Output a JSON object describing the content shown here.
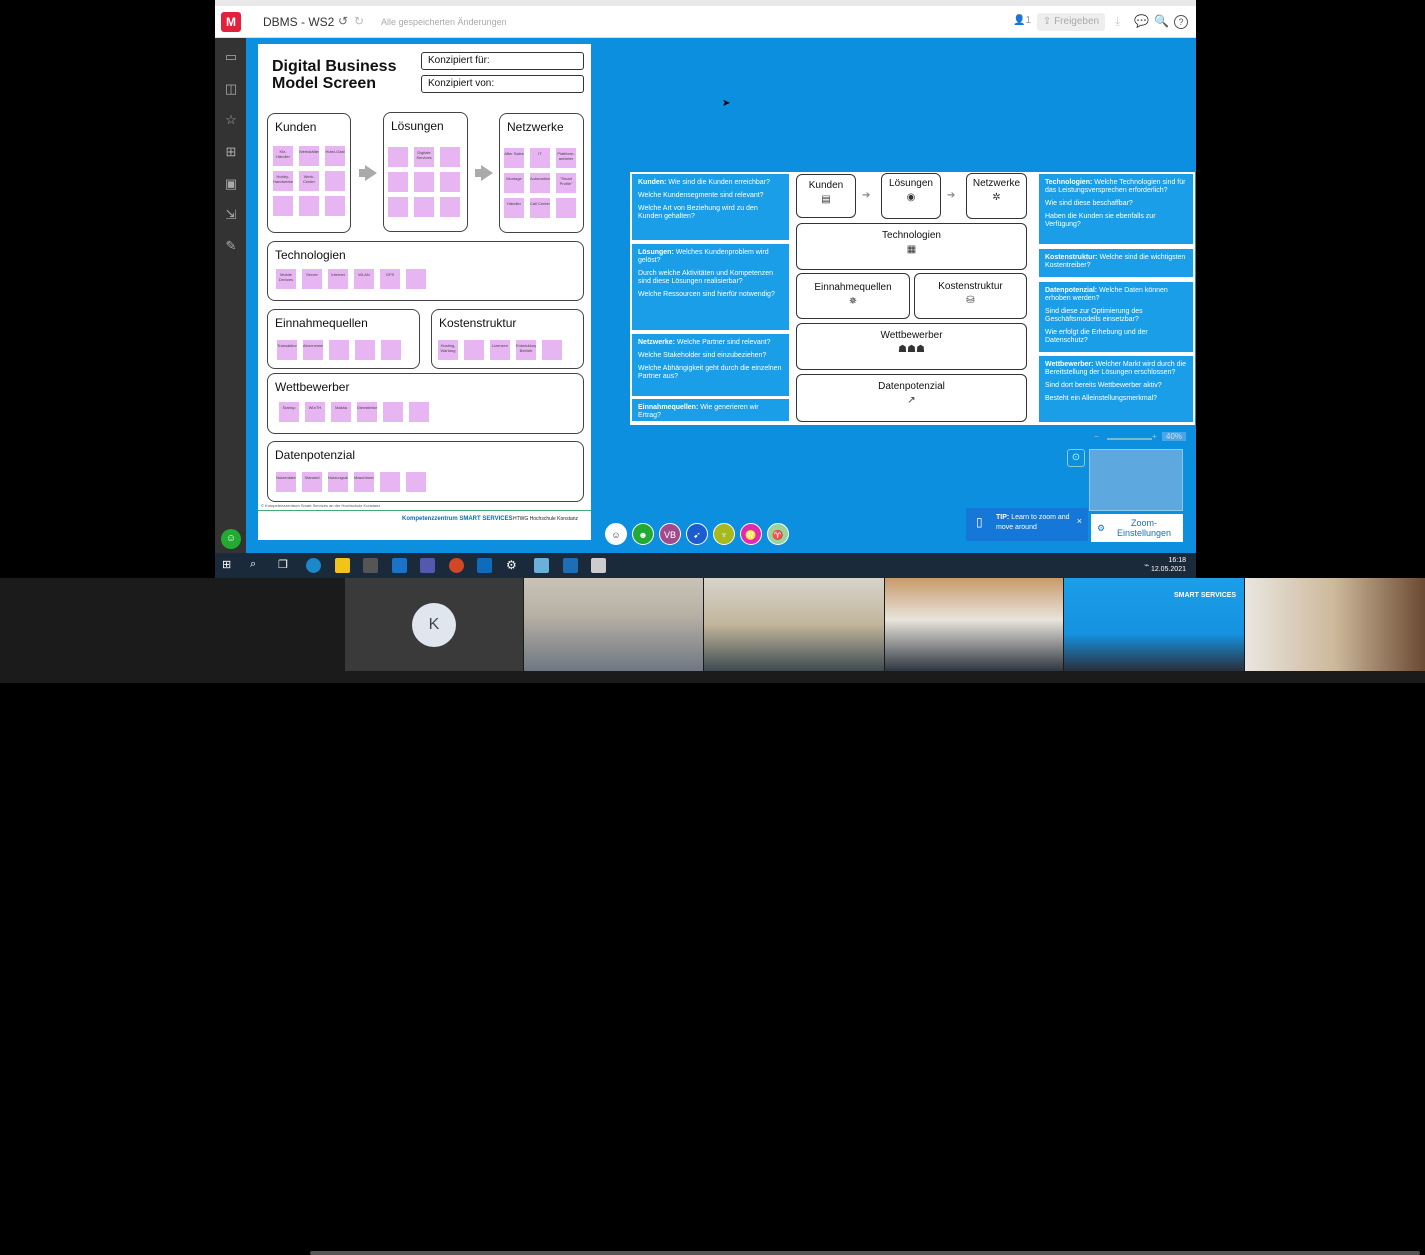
{
  "app": {
    "board_title": "DBMS - WS2",
    "save_status": "Alle gespeicherten Änderungen",
    "user_count": "1",
    "share_label": "Freigeben",
    "logo_letter": "M",
    "accent_color": "#e2223d",
    "board_bg": "#0d8fe0"
  },
  "paper": {
    "title": "Digital Business Model Screen",
    "conceived_for_label": "Konzipiert für:",
    "conceived_by_label": "Konzipiert von:",
    "sections": {
      "kunden": "Kunden",
      "loesungen": "Lösungen",
      "netzwerke": "Netzwerke",
      "technologien": "Technologien",
      "einnahmequellen": "Einnahmequellen",
      "kostenstruktur": "Kostenstruktur",
      "wettbewerber": "Wettbewerber",
      "datenpotenzial": "Datenpotenzial"
    },
    "sticky_notes": {
      "kunden": [
        "Kfz-Händler",
        "Werkstätten",
        "Hotel-Gast",
        "Hobby-Handwerker",
        "Werk-Center",
        "",
        "",
        "",
        ""
      ],
      "loesungen": [
        "",
        "Digitale Services",
        "",
        "",
        "",
        "",
        "",
        "",
        ""
      ],
      "netzwerke": [
        "After Sales",
        "IT",
        "Plattform-anbieter",
        "Montage",
        "Automation",
        "\"Smart Profile\"",
        "Händler",
        "Call Center",
        ""
      ],
      "technologien": [
        "Mobile Devices",
        "Server",
        "Internet",
        "WLAN",
        "GPS",
        ""
      ],
      "einnahmequellen": [
        "Transaktionen",
        "Abonnement",
        "",
        "",
        ""
      ],
      "kostenstruktur": [
        "Hosting, Wartung",
        "",
        "Lizenzen",
        "Entwicklung, Betrieb",
        ""
      ],
      "wettbewerber": [
        "Startup",
        "WürTH",
        "Makita",
        "Dienstleister",
        "",
        ""
      ],
      "datenpotenzial": [
        "Nutzerdaten",
        "Standort",
        "Nutzungsdaten",
        "Maschinendaten",
        "",
        ""
      ]
    },
    "footer": "© Kompetenzzentrum Smart Services an der Hochschule Konstanz",
    "logo_text": "Kompetenzzentrum SMART SERVICES",
    "htwg": "HTWG Hochschule Konstanz"
  },
  "screen_panel": {
    "left_questions": [
      {
        "head": "Kunden:",
        "lines": [
          "Wie sind die Kunden erreichbar?",
          "Welche Kundensegmente sind relevant?",
          "Welche Art von Beziehung wird zu den Kunden gehalten?"
        ]
      },
      {
        "head": "Lösungen:",
        "lines": [
          "Welches Kundenproblem wird gelöst?",
          "Durch welche Aktivitäten und Kompetenzen sind diese Lösungen realisierbar?",
          "Welche Ressourcen sind hierfür notwendig?"
        ]
      },
      {
        "head": "Netzwerke:",
        "lines": [
          "Welche Partner sind relevant?",
          "Welche Stakeholder sind einzubeziehen?",
          "Welche Abhängigkeit geht durch die einzelnen Partner aus?"
        ]
      },
      {
        "head": "Einnahmequellen:",
        "lines": [
          "Wie generieren wir Ertrag?"
        ]
      }
    ],
    "right_questions": [
      {
        "head": "Technologien:",
        "lines": [
          "Welche Technologien sind für das Leistungsversprechen erforderlich?",
          "Wie sind diese beschaffbar?",
          "Haben die Kunden sie ebenfalls zur Verfügung?"
        ]
      },
      {
        "head": "Kostenstruktur:",
        "lines": [
          "Welche sind die wichtigsten Kostentreiber?"
        ]
      },
      {
        "head": "Datenpotenzial:",
        "lines": [
          "Welche Daten können erhoben werden?",
          "Sind diese zur Optimierung des Geschäftsmodells einsetzbar?",
          "Wie erfolgt die Erhebung und der Datenschutz?"
        ]
      },
      {
        "head": "Wettbewerber:",
        "lines": [
          "Welcher Markt wird durch die Bereitstellung der Lösungen erschlossen?",
          "Sind dort bereits Wettbewerber aktiv?",
          "Besteht ein Alleinstellungsmerkmal?"
        ]
      }
    ],
    "boxes": {
      "kunden": "Kunden",
      "loesungen": "Lösungen",
      "netzwerke": "Netzwerke",
      "technologien": "Technologien",
      "einnahmequellen": "Einnahmequellen",
      "kostenstruktur": "Kostenstruktur",
      "wettbewerber": "Wettbewerber",
      "datenpotenzial": "Datenpotenzial"
    }
  },
  "collaborators": [
    "VB"
  ],
  "zoom": {
    "level": "40%",
    "tip_bold": "TIP:",
    "tip_text": "Learn to zoom and move around",
    "settings_label": "Zoom-Einstellungen"
  },
  "taskbar": {
    "time": "16:18",
    "date": "12.05.2021"
  },
  "video": {
    "participant_initial": "K",
    "smart_logo": "SMART SERVICES"
  }
}
